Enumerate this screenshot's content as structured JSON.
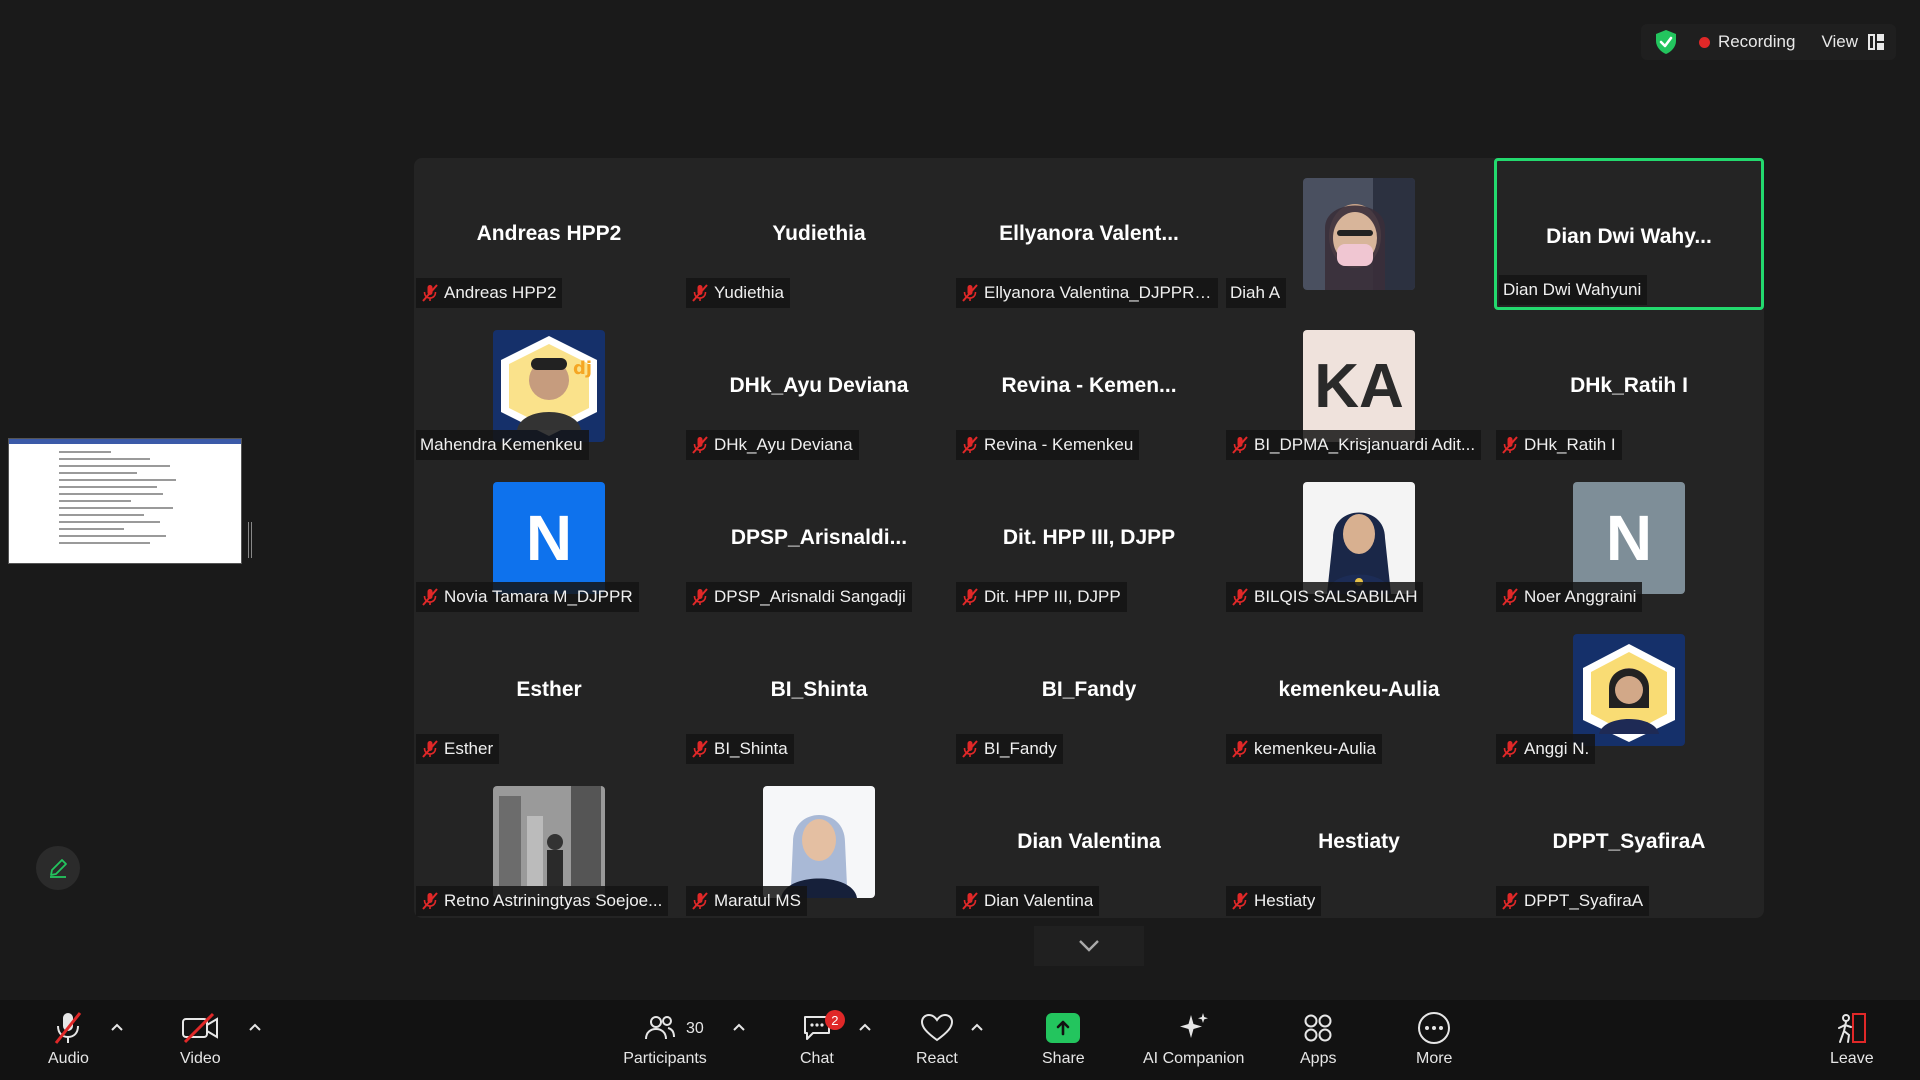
{
  "topbar": {
    "recording_label": "Recording",
    "view_label": "View"
  },
  "colors": {
    "active_speaker": "#23d96e",
    "recording": "#e02828",
    "share": "#23c55e",
    "avatar_blue": "#0e72ed"
  },
  "gallery": {
    "tiles": [
      {
        "big": "Andreas HPP2",
        "label": "Andreas HPP2",
        "muted": true
      },
      {
        "big": "Yudiethia",
        "label": "Yudiethia",
        "muted": true
      },
      {
        "big": "Ellyanora  Valent...",
        "label": "Ellyanora Valentina_DJPPR ...",
        "muted": true
      },
      {
        "photo": "photo-person-mask",
        "label": "Diah A",
        "muted": false
      },
      {
        "big": "Dian  Dwi  Wahy...",
        "label": "Dian Dwi Wahyuni",
        "muted": false,
        "active": true
      },
      {
        "photo": "photo-djp-profile",
        "label": "Mahendra Kemenkeu",
        "muted": false
      },
      {
        "big": "DHk_Ayu Deviana",
        "label": "DHk_Ayu Deviana",
        "muted": true
      },
      {
        "big": "Revina  -  Kemen...",
        "label": "Revina - Kemenkeu",
        "muted": true
      },
      {
        "initial": "KA",
        "style": "ka",
        "label": "BI_DPMA_Krisjanuardi Adit...",
        "muted": true
      },
      {
        "big": "DHk_Ratih I",
        "label": "DHk_Ratih I",
        "muted": true
      },
      {
        "initial": "N",
        "style": "blue",
        "label": "Novia Tamara M_DJPPR",
        "muted": true
      },
      {
        "big": "DPSP_Arisnaldi...",
        "label": "DPSP_Arisnaldi Sangadji",
        "muted": true
      },
      {
        "big": "Dit. HPP III, DJPP",
        "label": "Dit. HPP III, DJPP",
        "muted": true
      },
      {
        "photo": "photo-hijab-navy",
        "label": "BILQIS SALSABILAH",
        "muted": true
      },
      {
        "initial": "N",
        "style": "grey",
        "label": "Noer Anggraini",
        "muted": true
      },
      {
        "big": "Esther",
        "label": "Esther",
        "muted": true
      },
      {
        "big": "BI_Shinta",
        "label": "BI_Shinta",
        "muted": true
      },
      {
        "big": "BI_Fandy",
        "label": "BI_Fandy",
        "muted": true
      },
      {
        "big": "kemenkeu-Aulia",
        "label": "kemenkeu-Aulia",
        "muted": true
      },
      {
        "photo": "photo-djp-profile-2",
        "label": "Anggi N.",
        "muted": true
      },
      {
        "photo": "photo-city-bw",
        "label": "Retno Astriningtyas Soejoe...",
        "muted": true
      },
      {
        "photo": "photo-hijab-white",
        "label": "Maratul MS",
        "muted": true
      },
      {
        "big": "Dian Valentina",
        "label": "Dian Valentina",
        "muted": true
      },
      {
        "big": "Hestiaty",
        "label": "Hestiaty",
        "muted": true
      },
      {
        "big": "DPPT_SyafiraA",
        "label": "DPPT_SyafiraA",
        "muted": true
      }
    ]
  },
  "toolbar": {
    "audio": "Audio",
    "video": "Video",
    "participants": "Participants",
    "participants_count": "30",
    "chat": "Chat",
    "chat_badge": "2",
    "react": "React",
    "share": "Share",
    "ai_companion": "AI Companion",
    "apps": "Apps",
    "more": "More",
    "leave": "Leave"
  }
}
